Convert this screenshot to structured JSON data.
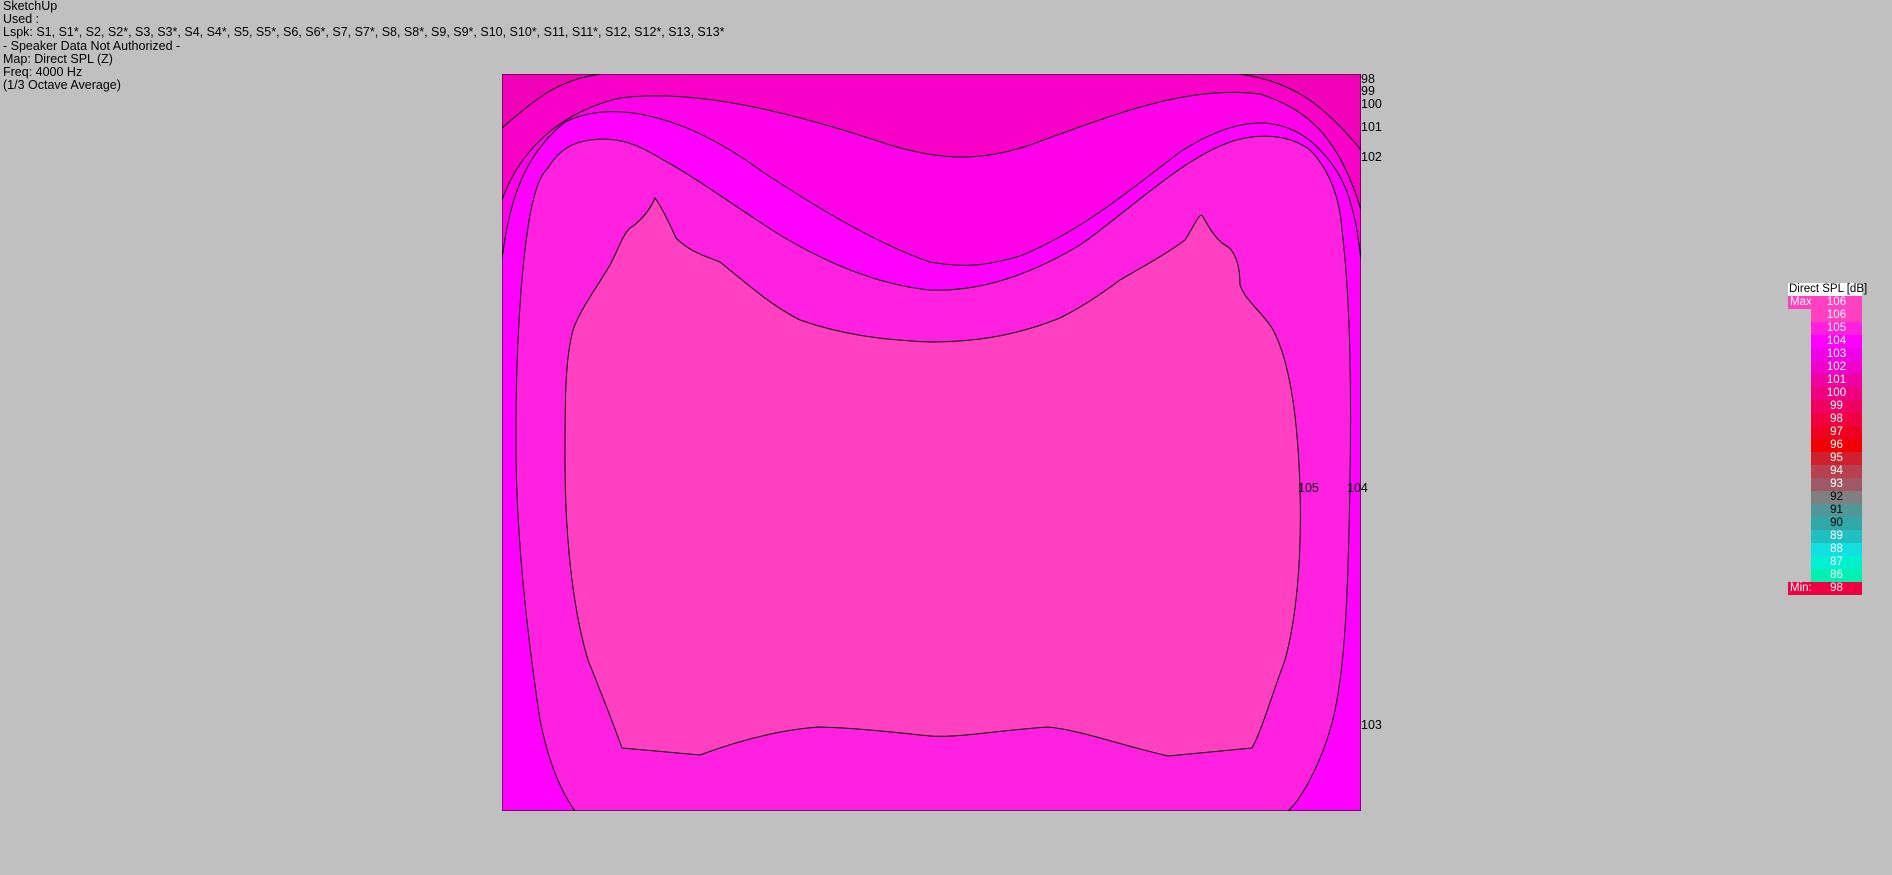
{
  "info": {
    "app": "SketchUp",
    "used_label": "Used :",
    "loudspeakers": "Lspk: S1, S1*, S2, S2*, S3, S3*, S4, S4*, S5, S5*, S6, S6*, S7, S7*, S8, S8*, S9, S9*, S10, S10*, S11, S11*, S12, S12*, S13, S13*",
    "authorization": "- Speaker Data Not Authorized -",
    "map": "Map: Direct SPL (Z)",
    "frequency": "Freq: 4000 Hz",
    "averaging": "(1/3 Octave Average)"
  },
  "contour_labels": {
    "l98": "98",
    "l99": "99",
    "l100": "100",
    "l101": "101",
    "l102": "102",
    "l105": "105",
    "l104": "104",
    "l103": "103"
  },
  "legend": {
    "title": "Direct SPL [dB]",
    "max_label": "Max:",
    "max_value": "106",
    "min_label": "Min:",
    "min_value": "98",
    "levels": [
      {
        "value": "106",
        "color": "#ff40c0"
      },
      {
        "value": "105",
        "color": "#ff20e0"
      },
      {
        "value": "104",
        "color": "#ff00ff"
      },
      {
        "value": "103",
        "color": "#f000e8"
      },
      {
        "value": "102",
        "color": "#f000c8"
      },
      {
        "value": "101",
        "color": "#f000a0"
      },
      {
        "value": "100",
        "color": "#f00080"
      },
      {
        "value": "99",
        "color": "#f00060"
      },
      {
        "value": "98",
        "color": "#f00040"
      },
      {
        "value": "97",
        "color": "#f00020"
      },
      {
        "value": "96",
        "color": "#f00000"
      },
      {
        "value": "95",
        "color": "#d02030"
      },
      {
        "value": "94",
        "color": "#b84050"
      },
      {
        "value": "93",
        "color": "#a05868"
      },
      {
        "value": "92",
        "color": "#808080"
      },
      {
        "value": "91",
        "color": "#509898"
      },
      {
        "value": "90",
        "color": "#30a8a8"
      },
      {
        "value": "89",
        "color": "#20c0c0"
      },
      {
        "value": "88",
        "color": "#10e0e0"
      },
      {
        "value": "87",
        "color": "#00f0d0"
      },
      {
        "value": "86",
        "color": "#00f0b0"
      }
    ],
    "max_color": "#ff40c0",
    "min_color": "#f00040"
  }
}
